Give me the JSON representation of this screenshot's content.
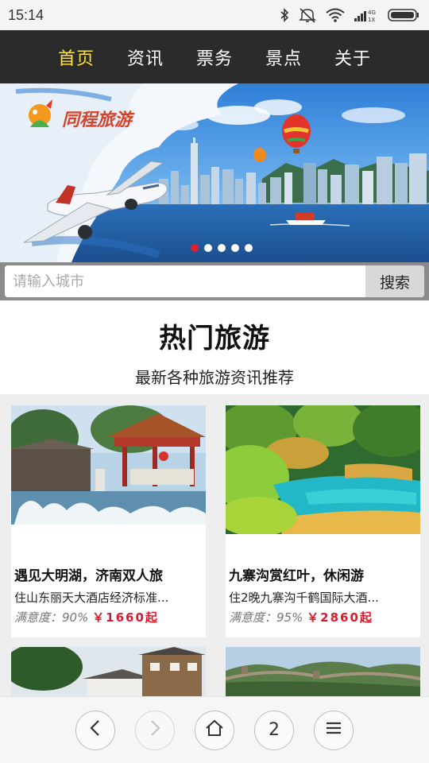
{
  "status_bar": {
    "time": "15:14",
    "network": "4G\n1X"
  },
  "nav": {
    "items": [
      "首页",
      "资讯",
      "票务",
      "景点",
      "关于"
    ],
    "active_index": 0,
    "active_color": "#ffe23a"
  },
  "banner": {
    "logo_text": "同程旅游",
    "slide_count": 5,
    "active_slide": 0
  },
  "search": {
    "placeholder": "请输入城市",
    "button_label": "搜索"
  },
  "section": {
    "title": "热门旅游",
    "subtitle": "最新各种旅游资讯推荐"
  },
  "cards": [
    {
      "name": "遇见大明湖，济南双人旅",
      "desc": "住山东丽天大酒店经济标准...",
      "sat_label": "满意度：",
      "sat_value": "90%",
      "price": "￥1660起"
    },
    {
      "name": "九寨沟赏红叶，休闲游",
      "desc": "住2晚九寨沟千鹤国际大酒...",
      "sat_label": "满意度：",
      "sat_value": "95%",
      "price": "￥2860起"
    }
  ],
  "bottom_bar": {
    "tab_count": "2"
  },
  "colors": {
    "nav_bg": "#2b2b2b",
    "price": "#e0182b",
    "dot_active": "#e02030"
  }
}
